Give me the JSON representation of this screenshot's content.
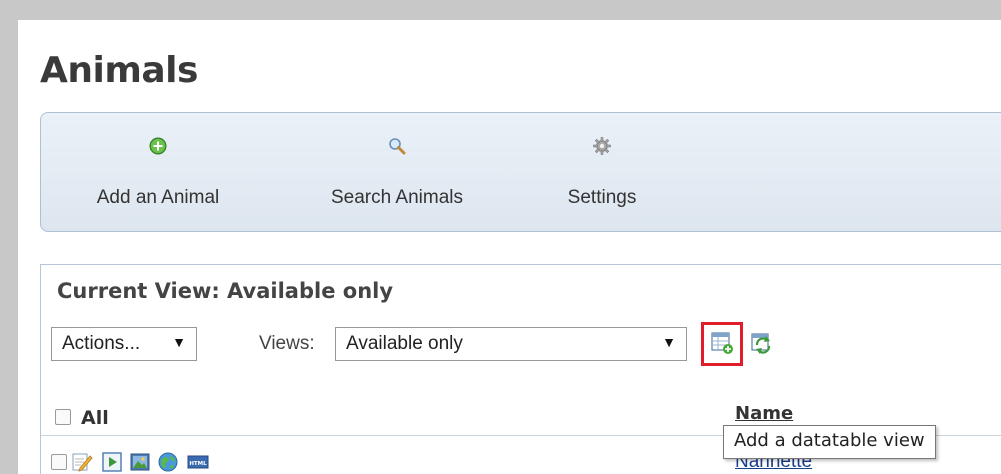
{
  "page": {
    "title": "Animals"
  },
  "toolbar": {
    "add_label": "Add an Animal",
    "add_icon": "plus-circle-icon",
    "search_label": "Search Animals",
    "search_icon": "magnifier-icon",
    "settings_label": "Settings",
    "settings_icon": "gear-icon"
  },
  "view": {
    "current": "Current View: Available only",
    "actions_label": "Actions...",
    "views_label": "Views:",
    "views_selected": "Available only"
  },
  "table": {
    "all_label": "All",
    "name_header": "Name",
    "rows": [
      {
        "name": "Nannette",
        "icons": [
          "edit-icon",
          "play-icon",
          "image-icon",
          "globe-icon",
          "html-icon"
        ]
      }
    ]
  },
  "tooltip": {
    "text": "Add a datatable view"
  },
  "colors": {
    "highlight": "#e01d2a",
    "link": "#1a3f8c",
    "toolbar_border": "#aec0d2"
  }
}
